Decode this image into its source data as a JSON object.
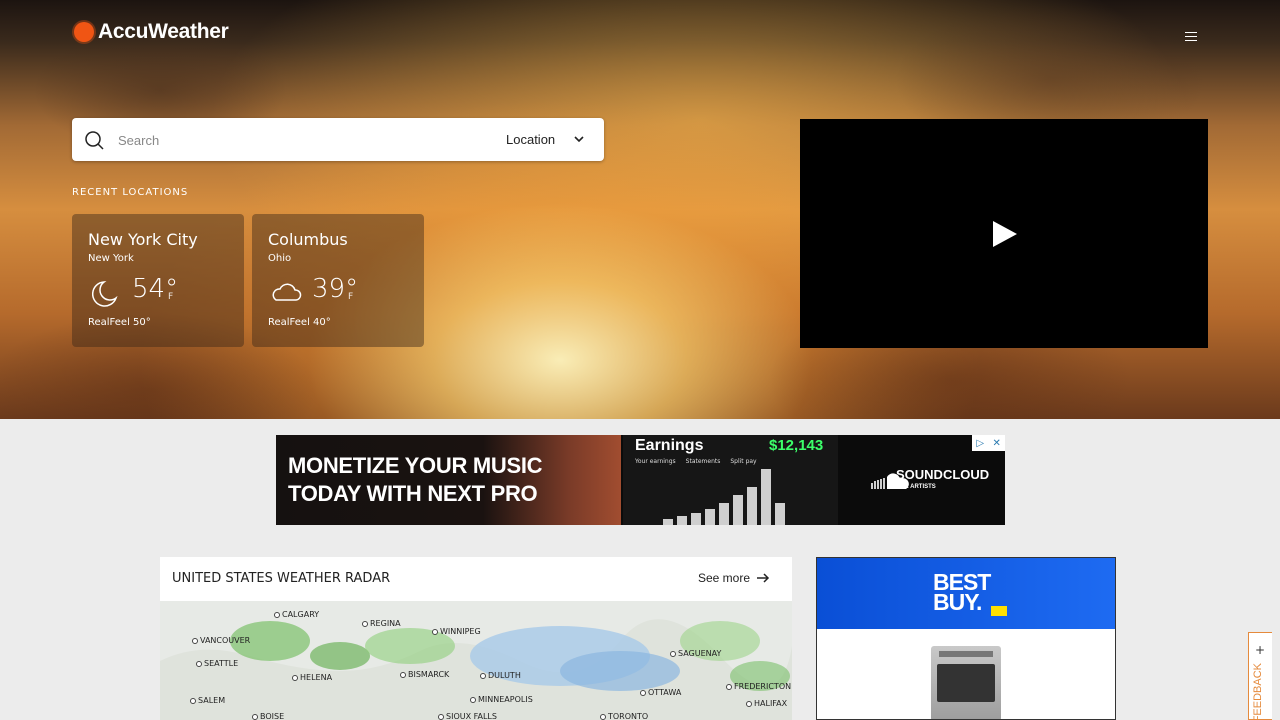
{
  "header": {
    "logo_text": "AccuWeather",
    "brand_color": "#f05514"
  },
  "search": {
    "placeholder": "Search",
    "location_label": "Location"
  },
  "recent": {
    "heading": "RECENT LOCATIONS",
    "cards": [
      {
        "city": "New York City",
        "region": "New York",
        "icon": "moon-icon",
        "temp": "54°",
        "unit": "F",
        "realfeel": "RealFeel 50°"
      },
      {
        "city": "Columbus",
        "region": "Ohio",
        "icon": "cloud-icon",
        "temp": "39°",
        "unit": "F",
        "realfeel": "RealFeel 40°"
      }
    ]
  },
  "ad_banner": {
    "line1": "MONETIZE YOUR MUSIC",
    "line2": "TODAY WITH NEXT PRO",
    "earnings_title": "Earnings",
    "earnings_amount": "$12,143",
    "earnings_tabs": [
      "Your earnings",
      "Statements",
      "Split pay"
    ],
    "brand": "SOUNDCLOUD",
    "brand_sub": "FOR ARTISTS",
    "earnings_color": "#3cff6a"
  },
  "radar": {
    "title": "UNITED STATES WEATHER RADAR",
    "see_more": "See more",
    "cities": [
      {
        "name": "CALGARY"
      },
      {
        "name": "REGINA"
      },
      {
        "name": "WINNIPEG"
      },
      {
        "name": "VANCOUVER"
      },
      {
        "name": "SEATTLE"
      },
      {
        "name": "HELENA"
      },
      {
        "name": "BISMARCK"
      },
      {
        "name": "DULUTH"
      },
      {
        "name": "SAGUENAY"
      },
      {
        "name": "SALEM"
      },
      {
        "name": "MINNEAPOLIS"
      },
      {
        "name": "OTTAWA"
      },
      {
        "name": "FREDERICTON"
      },
      {
        "name": "HALIFAX"
      },
      {
        "name": "BOISE"
      },
      {
        "name": "SIOUX FALLS"
      },
      {
        "name": "TORONTO"
      }
    ]
  },
  "side_ad": {
    "logo_line1": "BEST",
    "logo_line2": "BUY."
  },
  "feedback": {
    "label": "FEEDBACK",
    "plus": "+"
  }
}
